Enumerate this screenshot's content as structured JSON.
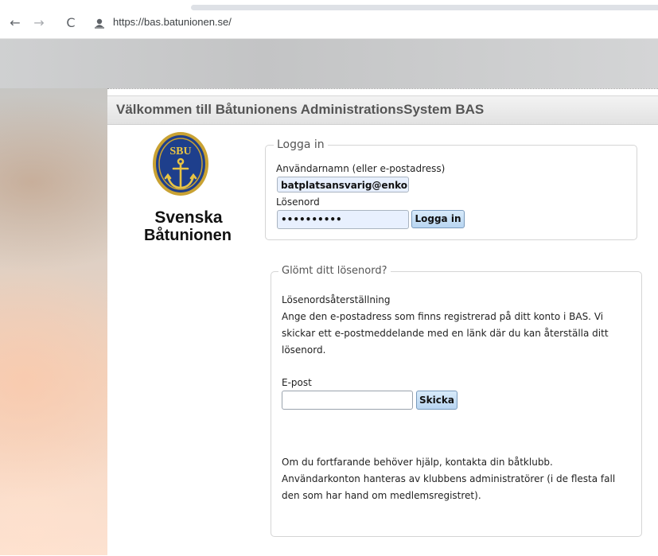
{
  "browser": {
    "url": "https://bas.batunionen.se/",
    "back_icon": "←",
    "forward_icon": "→",
    "reload_icon": "C"
  },
  "page": {
    "title": "Välkommen till Båtunionens AdministrationsSystem BAS",
    "logo": {
      "badge_text": "SBU",
      "line1": "Svenska",
      "line2": "Båtunionen"
    },
    "login": {
      "legend": "Logga in",
      "username_label": "Användarnamn (eller e-postadress)",
      "username_value": "batplatsansvarig@enkop",
      "password_label": "Lösenord",
      "password_value": "••••••••••",
      "submit_label": "Logga in"
    },
    "forgot": {
      "legend": "Glömt ditt lösenord?",
      "heading": "Lösenordsåterställning",
      "description_line1": "Ange den e-postadress som finns registrerad på ditt konto i BAS. Vi",
      "description_line2": "skickar ett e-postmeddelande med en länk där du kan återställa ditt",
      "description_line3": "lösenord.",
      "email_label": "E-post",
      "email_value": "",
      "submit_label": "Skicka",
      "help_line1": "Om du fortfarande behöver hjälp, kontakta din båtklubb.",
      "help_line2": "Användarkonton hanteras av klubbens administratörer (i de flesta fall",
      "help_line3": "den som har hand om medlemsregistret)."
    }
  }
}
